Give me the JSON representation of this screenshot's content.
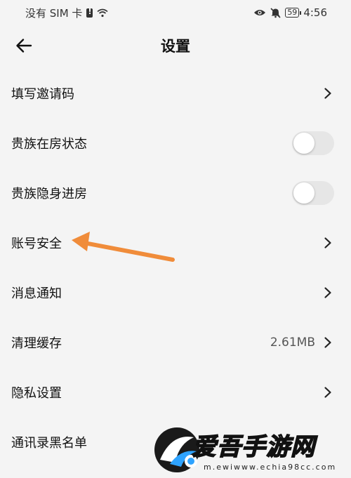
{
  "status_bar": {
    "carrier": "没有 SIM 卡",
    "battery": "59",
    "time": "4:56"
  },
  "header": {
    "title": "设置",
    "back_icon": "arrow-left-icon"
  },
  "settings": {
    "invite_code": "填写邀请码",
    "noble_room_status": "贵族在房状态",
    "noble_invisible": "贵族隐身进房",
    "account_security": "账号安全",
    "notifications": "消息通知",
    "clear_cache": "清理缓存",
    "cache_size": "2.61MB",
    "privacy": "隐私设置",
    "contacts_blacklist": "通讯录黑名单"
  },
  "toggles": {
    "noble_room_status": false,
    "noble_invisible": false
  },
  "annotation": {
    "arrow_color": "#f08c3a"
  },
  "watermark": {
    "text": "爱吾手游网",
    "url": "m.ewiwww.echia98cc.com"
  }
}
